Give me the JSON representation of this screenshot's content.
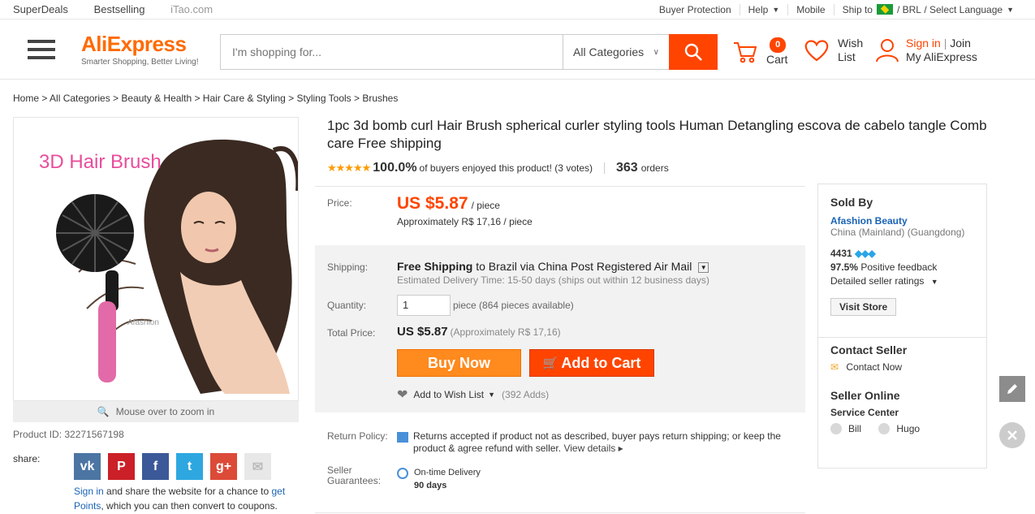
{
  "topbar": {
    "left": [
      "SuperDeals",
      "Bestselling",
      "iTao.com"
    ],
    "buyer_protection": "Buyer Protection",
    "help": "Help",
    "mobile": "Mobile",
    "ship_to": "Ship to",
    "currency": "/ BRL",
    "language": "/ Select Language"
  },
  "header": {
    "logo": "AliExpress",
    "tagline": "Smarter Shopping, Better Living!",
    "search_placeholder": "I'm shopping for...",
    "category": "All Categories",
    "cart_count": "0",
    "cart_label": "Cart",
    "wish_1": "Wish",
    "wish_2": "List",
    "sign_in": "Sign in",
    "join": "Join",
    "my_account": "My AliExpress"
  },
  "breadcrumb": "Home > All Categories > Beauty & Health > Hair Care & Styling > Styling Tools > Brushes",
  "gallery": {
    "image_text": "3D Hair Brush",
    "watermark": "Afashion",
    "zoom_hint": "Mouse over to zoom in",
    "product_id": "Product ID: 32271567198"
  },
  "share": {
    "label": "share:",
    "sign_in": "Sign in",
    "text_1": " and share the website for a chance to ",
    "get_points": "get Points",
    "text_2": ", which you can then convert to coupons."
  },
  "product": {
    "title": "1pc 3d bomb curl Hair Brush spherical curler styling tools Human Detangling escova de cabelo tangle Comb care Free shipping",
    "rating_pct": "100.0%",
    "rating_text": "of buyers enjoyed this product! (3 votes)",
    "orders_count": "363",
    "orders_label": "orders",
    "stars": 5
  },
  "pricing": {
    "price_label": "Price:",
    "price": "US $5.87",
    "per_piece": "/ piece",
    "approx": "Approximately R$ 17,16 / piece",
    "shipping_label": "Shipping:",
    "free_shipping": "Free Shipping",
    "shipping_dest": "to  Brazil via China Post Registered Air Mail",
    "delivery": "Estimated Delivery Time: 15-50 days (ships out within 12 business days)",
    "quantity_label": "Quantity:",
    "quantity": "1",
    "available": "piece (864 pieces available)",
    "total_label": "Total Price:",
    "total": "US $5.87",
    "total_approx": "(Approximately R$ 17,16)",
    "buy_now": "Buy Now",
    "add_to_cart": "Add to Cart",
    "wish_list": "Add to Wish List",
    "wish_adds": "(392 Adds)"
  },
  "policy": {
    "return_label": "Return Policy:",
    "return_text": "Returns accepted if product not as described, buyer pays return shipping; or keep the product & agree refund with seller.",
    "view_details": "View details",
    "guarantee_label_1": "Seller",
    "guarantee_label_2": "Guarantees:",
    "delivery_title": "On-time Delivery",
    "delivery_days": "90 days"
  },
  "seller": {
    "sold_by": "Sold By",
    "store": "Afashion Beauty",
    "location": "China (Mainland) (Guangdong)",
    "score": "4431",
    "feedback_pct": "97.5%",
    "feedback_text": "Positive feedback",
    "detailed": "Detailed seller ratings",
    "visit": "Visit Store",
    "contact_title": "Contact Seller",
    "contact_now": "Contact Now",
    "online_title": "Seller Online",
    "service_center": "Service Center",
    "agents": [
      "Bill",
      "Hugo"
    ]
  },
  "colors": {
    "brand_orange": "#ff6a00",
    "action_red": "#ff4400",
    "buy_orange": "#ff8a1e",
    "link_blue": "#1a63b5"
  }
}
